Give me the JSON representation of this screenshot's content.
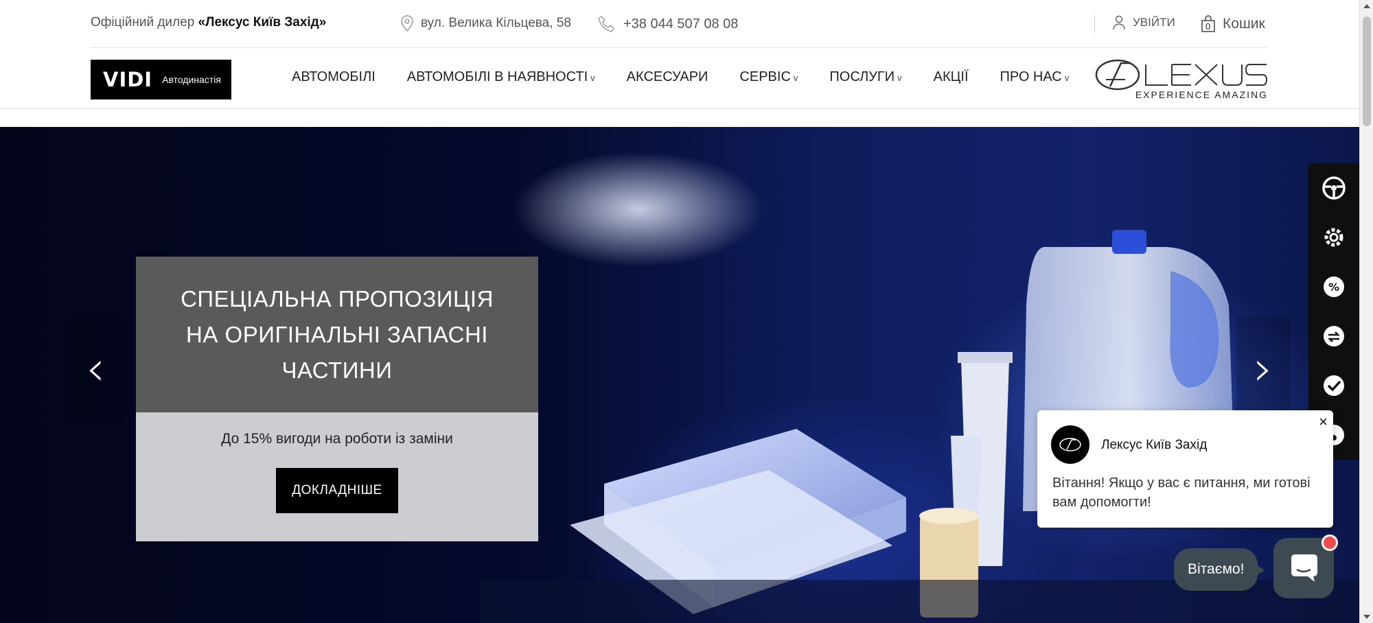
{
  "topbar": {
    "dealer_prefix": "Офіційний дилер ",
    "dealer_name": "«Лексус Київ Захід»",
    "address": "вул. Велика Кільцева, 58",
    "phone": "+38 044 507 08 08",
    "login": "УВІЙТИ",
    "cart_label": "Кошик",
    "cart_count": "0"
  },
  "brand": {
    "vidi": "VIDI",
    "vidi_sub": "Автодинастія",
    "lexus_tagline": "EXPERIENCE AMAZING"
  },
  "nav": {
    "items": [
      {
        "label": "АВТОМОБІЛІ",
        "has_dropdown": false
      },
      {
        "label": "АВТОМОБІЛІ В НАЯВНОСТІ",
        "has_dropdown": true
      },
      {
        "label": "АКСЕСУАРИ",
        "has_dropdown": false
      },
      {
        "label": "СЕРВІС",
        "has_dropdown": true
      },
      {
        "label": "ПОСЛУГИ",
        "has_dropdown": true
      },
      {
        "label": "АКЦІЇ",
        "has_dropdown": false
      },
      {
        "label": "ПРО НАС",
        "has_dropdown": true
      }
    ],
    "chevron": "v"
  },
  "hero": {
    "title": "СПЕЦІАЛЬНА ПРОПОЗИЦІЯ НА ОРИГІНАЛЬНІ ЗАПАСНІ ЧАСТИНИ",
    "subtitle": "До 15% вигоди на роботи із заміни",
    "button": "ДОКЛАДНІШЕ",
    "prev_arrow": "‹",
    "next_arrow": "›"
  },
  "sidebar": {
    "icons": [
      "steering-wheel-icon",
      "service-gear-icon",
      "discount-icon",
      "trade-in-icon",
      "checkmark-icon",
      "more-icon"
    ]
  },
  "chat": {
    "name": "Лексус Київ Захід",
    "message": "Вітання! Якщо у вас є питання, ми готові вам допомогти! ",
    "greet": "Вітаємо!",
    "close": "×"
  },
  "colors": {
    "promo_top": "#5a5a5a",
    "promo_bottom": "#cccdd1",
    "button": "#000000",
    "chat_bubble": "#3d4a52",
    "notify_dot": "#f24b4b",
    "hero_bg": "#0d1c5a"
  }
}
